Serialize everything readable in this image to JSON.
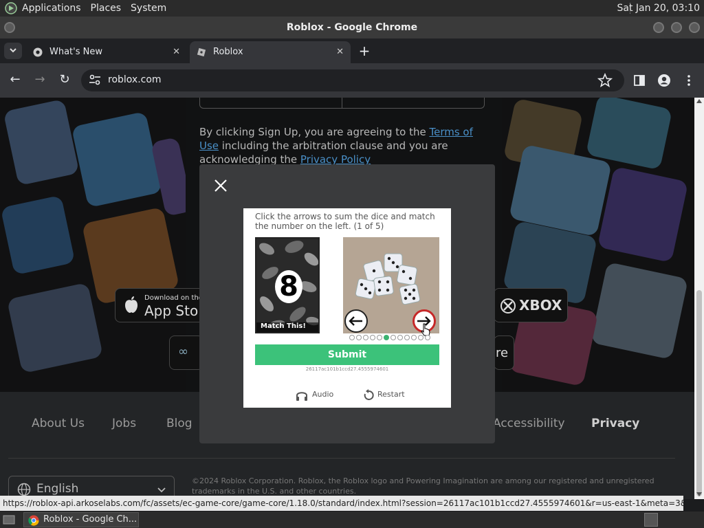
{
  "top_panel": {
    "menus": [
      "Applications",
      "Places",
      "System"
    ],
    "clock": "Sat Jan 20, 03:10"
  },
  "window": {
    "title": "Roblox - Google Chrome"
  },
  "tabs": [
    {
      "label": "What's New",
      "active": false
    },
    {
      "label": "Roblox",
      "active": true
    }
  ],
  "toolbar": {
    "url": "roblox.com"
  },
  "page": {
    "terms_prefix": "By clicking Sign Up, you are agreeing to the ",
    "terms_link": "Terms of Use",
    "terms_middle": " including the arbitration clause and you are acknowledging the ",
    "privacy_link": "Privacy Policy",
    "store_apple_small": "Download on the",
    "store_apple_big": "App Store",
    "store_xbox": "XBOX",
    "store_other": "re",
    "footer_links": [
      "About Us",
      "Jobs",
      "Blog",
      "Accessibility",
      "Privacy"
    ],
    "language": "English",
    "copyright": "©2024 Roblox Corporation. Roblox, the Roblox logo and Powering Imagination are among our registered and unregistered trademarks in the U.S. and other countries."
  },
  "captcha": {
    "prompt": "Click the arrows to sum the dice and match the number on the left. (1 of 5)",
    "target_number": "8",
    "match_label": "Match This!",
    "submit_label": "Submit",
    "session_id": "26117ac101b1ccd27.4555974601",
    "audio_label": "Audio",
    "restart_label": "Restart",
    "dot_count": 12,
    "active_dot": 5
  },
  "status_url": "https://roblox-api.arkoselabs.com/fc/assets/ec-game-core/game-core/1.18.0/standard/index.html?session=26117ac101b1ccd27.4555974601&r=us-east-1&meta=3&meta...",
  "taskbar": {
    "task_label": "Roblox - Google Ch..."
  }
}
